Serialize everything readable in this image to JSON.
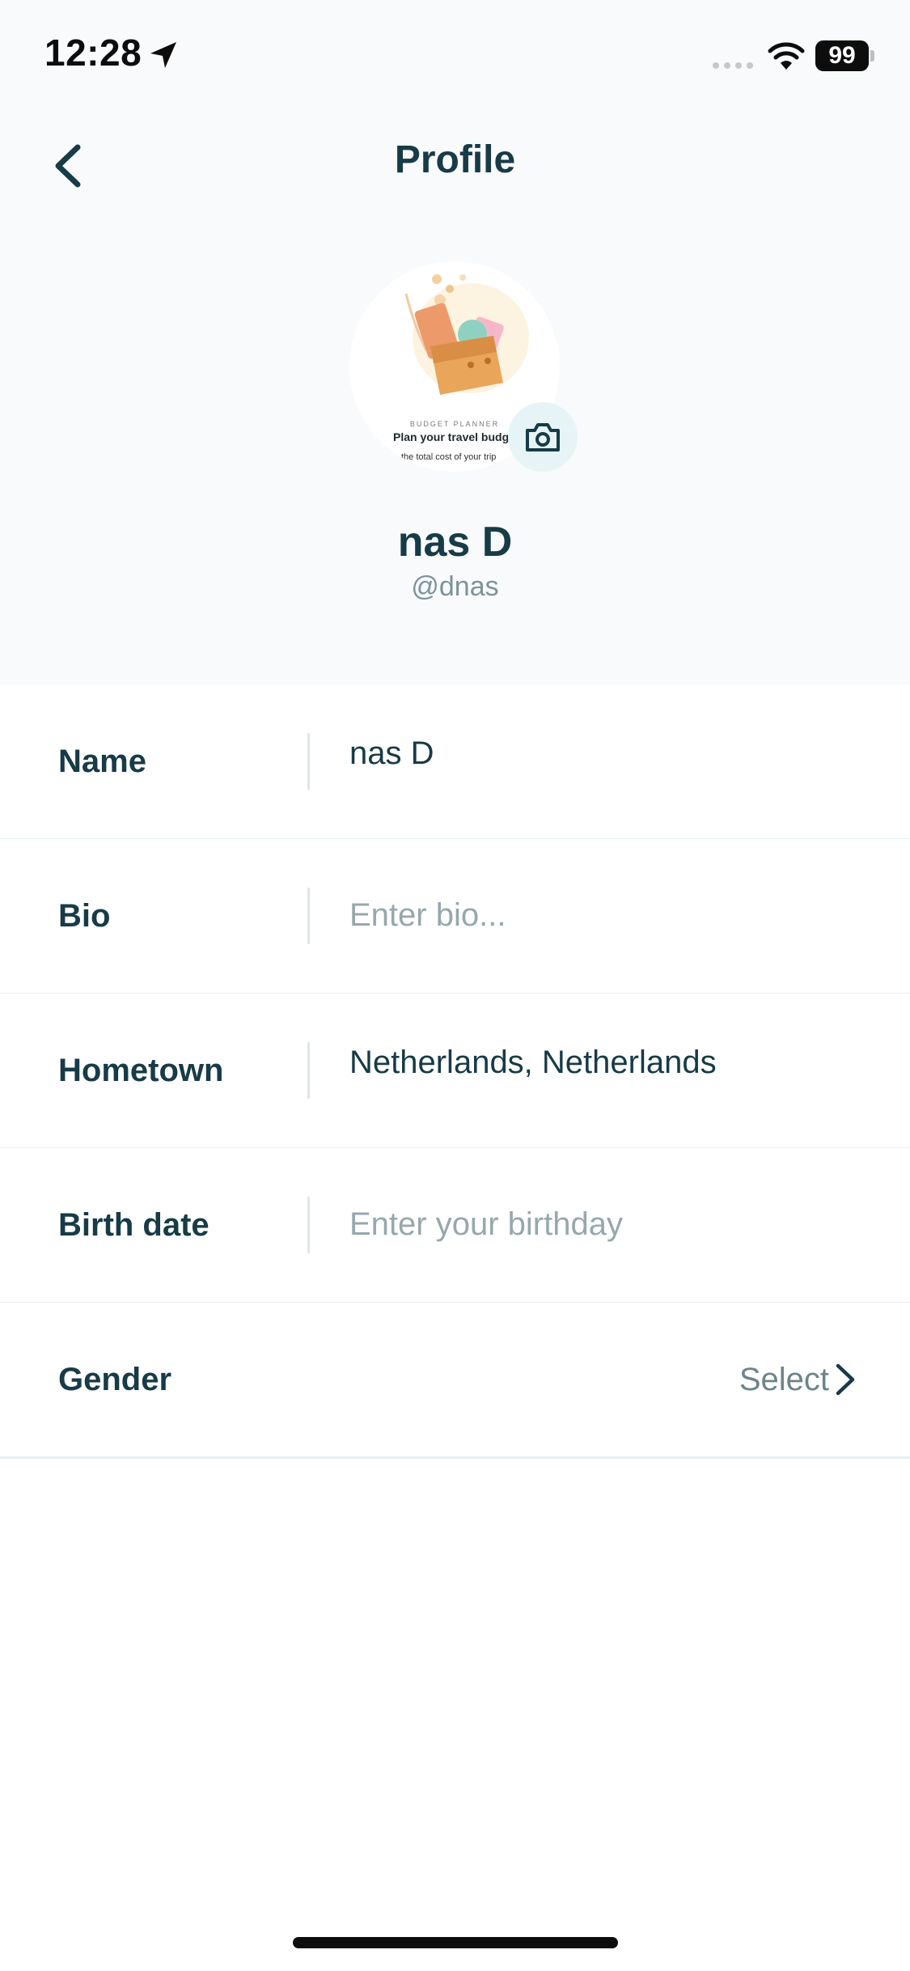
{
  "status_bar": {
    "time": "12:28",
    "battery": "99"
  },
  "header": {
    "title": "Profile"
  },
  "profile": {
    "avatar_caption_small": "BUDGET PLANNER",
    "avatar_caption_title": "Plan your travel budget",
    "avatar_caption_sub": "the total cost of your trip",
    "name": "nas D",
    "handle": "@dnas"
  },
  "form": {
    "name": {
      "label": "Name",
      "value": "nas D"
    },
    "bio": {
      "label": "Bio",
      "placeholder": "Enter bio..."
    },
    "hometown": {
      "label": "Hometown",
      "value": "Netherlands, Netherlands"
    },
    "birth_date": {
      "label": "Birth date",
      "placeholder": "Enter your birthday"
    },
    "gender": {
      "label": "Gender",
      "value": "Select"
    }
  },
  "colors": {
    "primary_text": "#173b47",
    "secondary_text": "#7d9499",
    "header_bg": "#f8fafc",
    "camera_bg": "#e6f4f6"
  },
  "icons": [
    "location-arrow-icon",
    "cellular-signal-icon",
    "wifi-icon",
    "battery-icon",
    "chevron-left-icon",
    "camera-icon",
    "chevron-right-icon"
  ]
}
